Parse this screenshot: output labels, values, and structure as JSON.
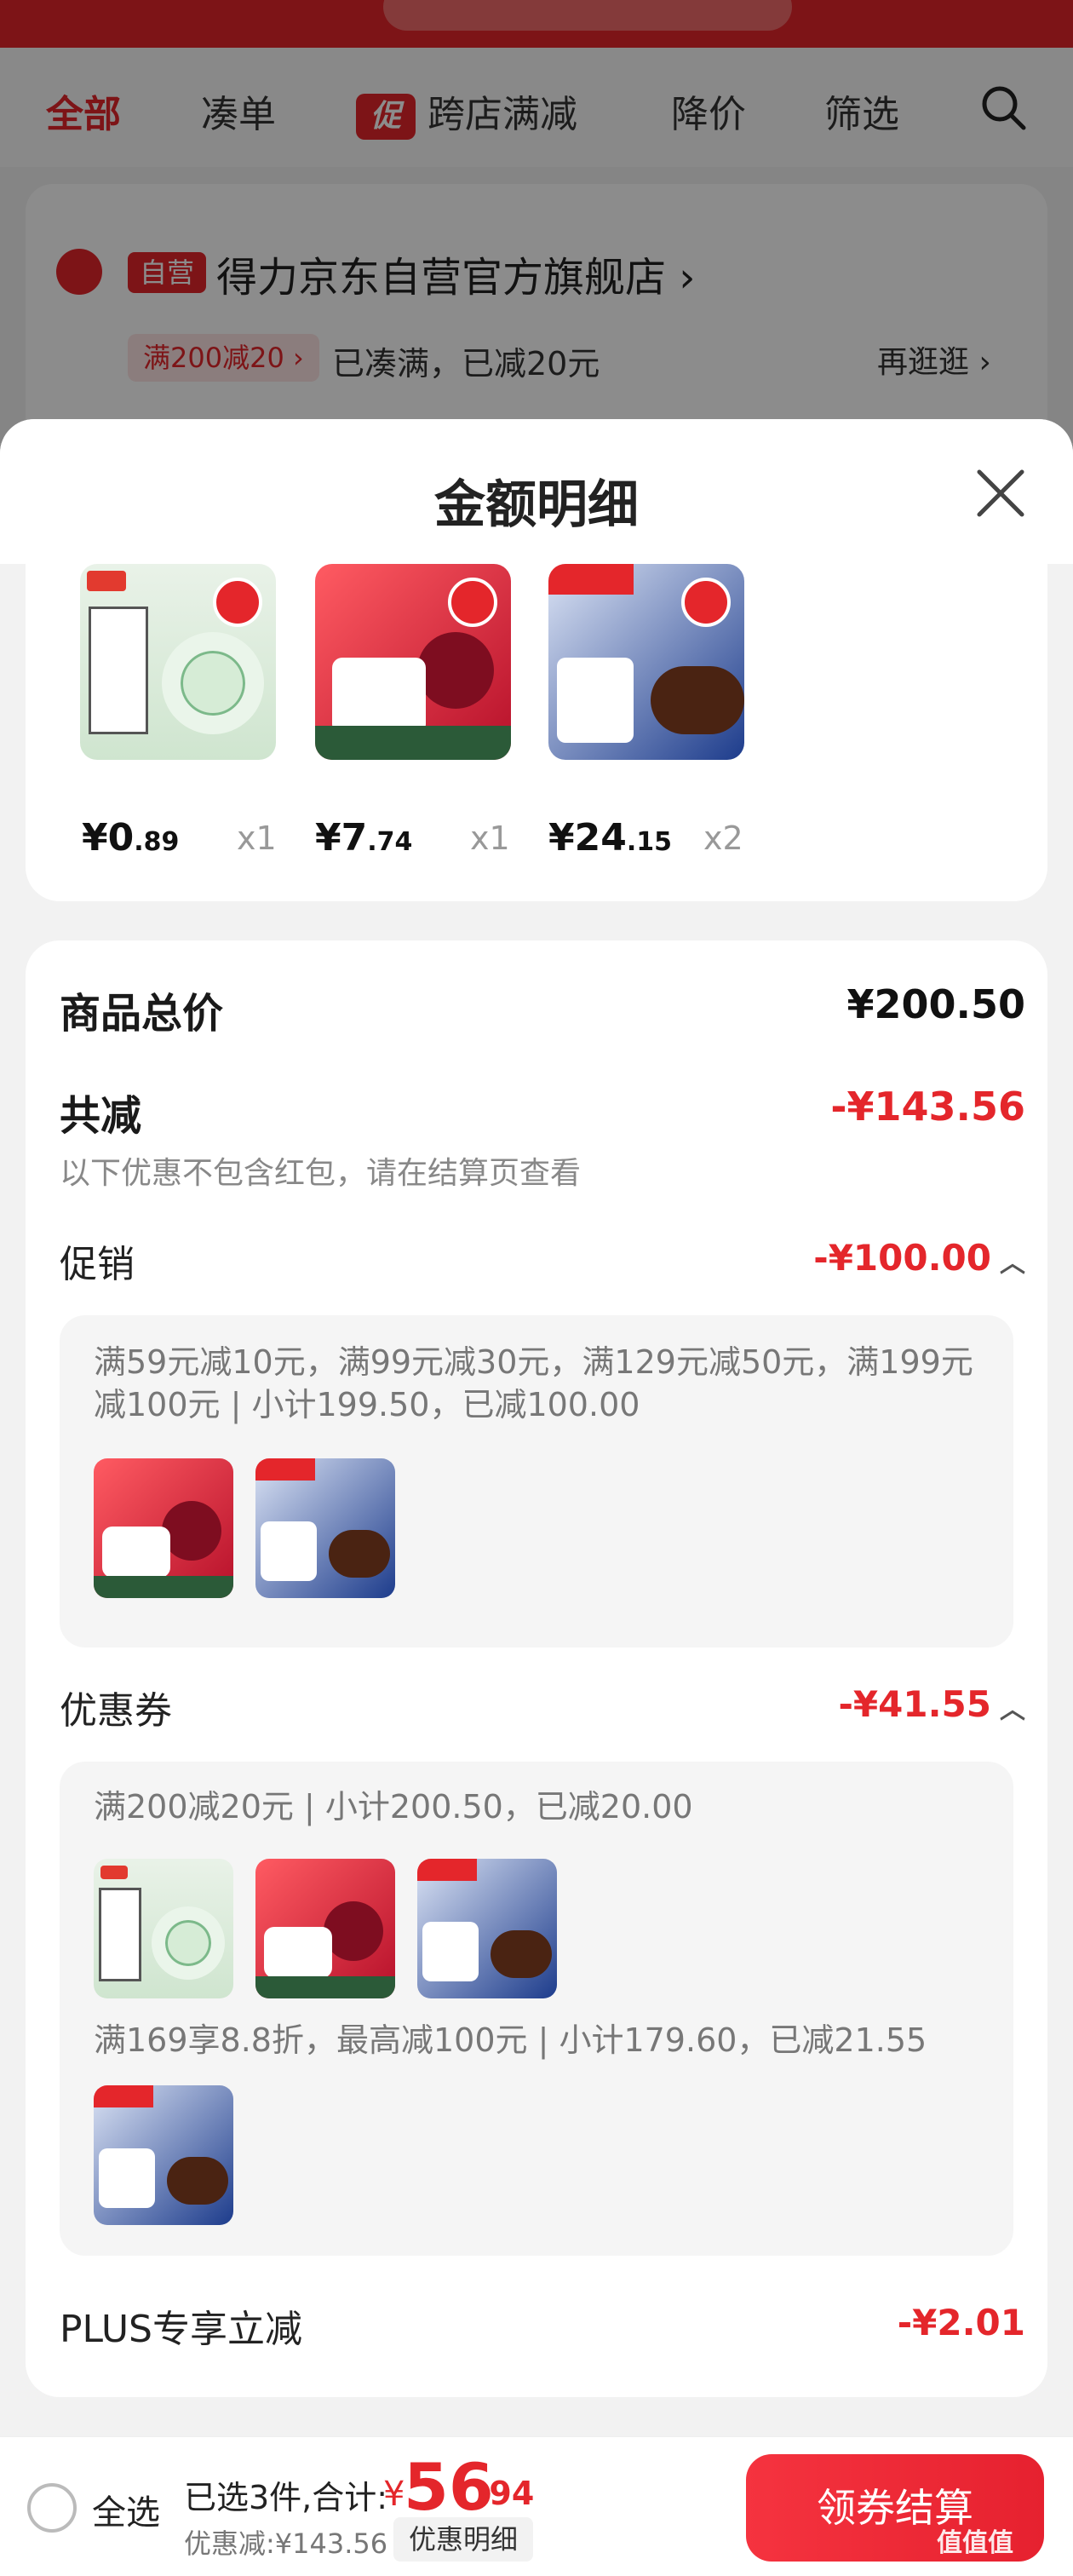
{
  "background": {
    "tabs": [
      {
        "label": "全部",
        "active": true
      },
      {
        "label": "凑单",
        "active": false
      },
      {
        "label": "跨店满减",
        "badge": "促",
        "active": false
      },
      {
        "label": "降价",
        "active": false
      },
      {
        "label": "筛选",
        "active": false
      }
    ],
    "shop": {
      "tag": "自营",
      "name": "得力京东自营官方旗舰店 ›",
      "promo_badge": "满200减20 ›",
      "promo_text": "已凑满，已减20元",
      "more": "再逛逛 ›"
    }
  },
  "sheet": {
    "title": "金额明细"
  },
  "products": [
    {
      "icon": "tape-product-image",
      "price_int": "¥0",
      "price_dec": ".89",
      "qty": "x1"
    },
    {
      "icon": "juice-product-image",
      "price_int": "¥7",
      "price_dec": ".74",
      "qty": "x1"
    },
    {
      "icon": "beef-jerky-product-image",
      "price_int": "¥24",
      "price_dec": ".15",
      "qty": "x2"
    }
  ],
  "summary": {
    "total_label": "商品总价",
    "total_value": "¥200.50",
    "discount_label": "共减",
    "discount_value": "-¥143.56",
    "discount_note": "以下优惠不包含红包，请在结算页查看"
  },
  "promotion": {
    "label": "促销",
    "value": "-¥100.00",
    "detail": "满59元减10元，满99元减30元，满129元减50元，满199元减100元 | 小计199.50，已减100.00"
  },
  "coupon": {
    "label": "优惠券",
    "value": "-¥41.55",
    "detail1": "满200减20元 | 小计200.50，已减20.00",
    "detail2": "满169享8.8折，最高减100元 | 小计179.60，已减21.55"
  },
  "plus": {
    "label": "PLUS专享立减",
    "value": "-¥2.01"
  },
  "bottom": {
    "select_all": "全选",
    "selected": "已选3件,合计:",
    "yen": "¥",
    "total_int": "56",
    "total_dec": ".94",
    "saved": "优惠减:¥143.56",
    "detail_link": "优惠明细",
    "checkout": "领券结算"
  },
  "watermark": "值值值"
}
